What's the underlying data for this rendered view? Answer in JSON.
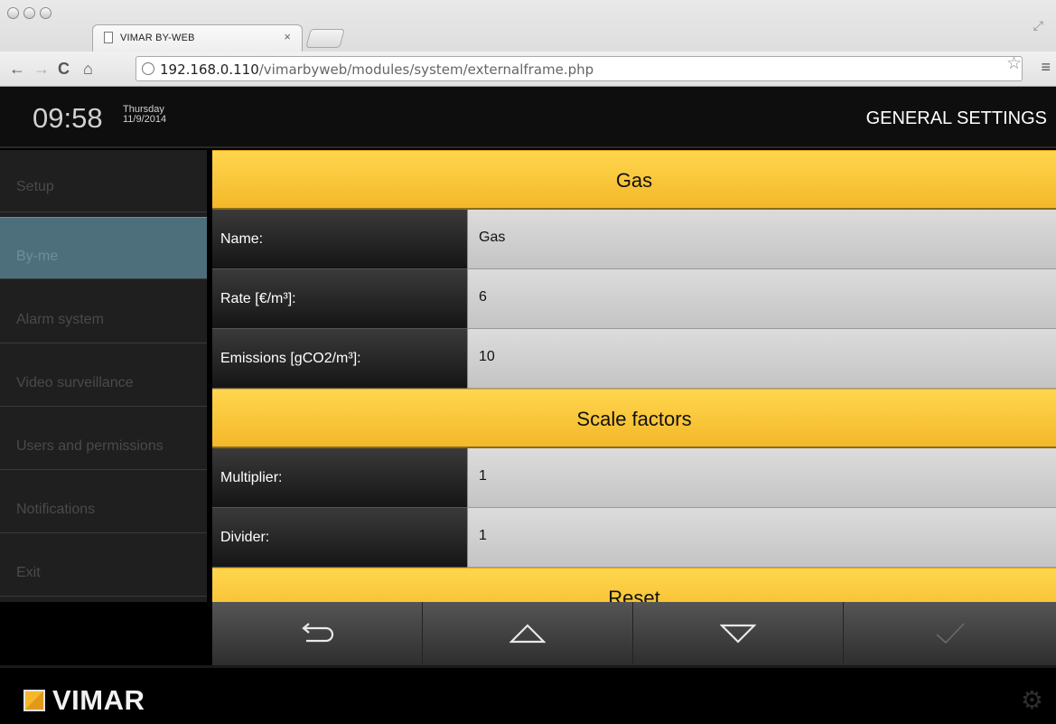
{
  "browser": {
    "tab_title": "VIMAR BY-WEB",
    "tab_close": "×",
    "url_host": "192.168.0.110",
    "url_path": "/vimarbyweb/modules/system/externalframe.php"
  },
  "header": {
    "time": "09:58",
    "weekday": "Thursday",
    "date": "11/9/2014",
    "title": "GENERAL SETTINGS"
  },
  "sidebar": {
    "items": [
      {
        "label": "Setup"
      },
      {
        "label": "By-me"
      },
      {
        "label": "Alarm system"
      },
      {
        "label": "Video surveillance"
      },
      {
        "label": "Users and permissions"
      },
      {
        "label": "Notifications"
      },
      {
        "label": "Exit"
      }
    ]
  },
  "main": {
    "section1": "Gas",
    "rows1": [
      {
        "label": "Name:",
        "value": "Gas"
      },
      {
        "label": "Rate [€/m³]:",
        "value": "6"
      },
      {
        "label": "Emissions [gCO2/m³]:",
        "value": "10"
      }
    ],
    "section2": "Scale factors",
    "rows2": [
      {
        "label": "Multiplier:",
        "value": "1"
      },
      {
        "label": "Divider:",
        "value": "1"
      }
    ],
    "section3": "Reset"
  },
  "footer": {
    "logo": "VIMAR"
  },
  "colors": {
    "accent": "#f4b82a",
    "active_item": "#4d6f7c"
  }
}
